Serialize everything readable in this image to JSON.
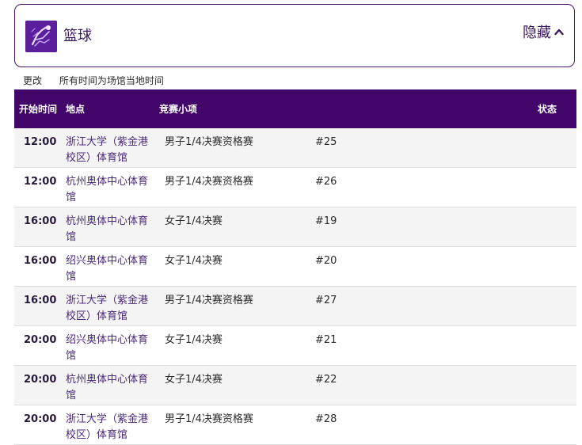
{
  "sport": {
    "title": "篮球",
    "hide_label": "隐藏",
    "logo_color": "#5c1f9c",
    "card_border_color": "#4a1466",
    "toggle_icon": "chevron-up-icon"
  },
  "subbar": {
    "change_label": "更改",
    "timezone_note": "所有时间为场馆当地时间"
  },
  "table": {
    "header_color": "#42066b",
    "columns": {
      "time": "开始时间",
      "venue": "地点",
      "event": "竞赛小项",
      "status": "状态"
    },
    "rows": [
      {
        "time": "12:00",
        "venue": "浙江大学（紫金港校区）体育馆",
        "event": "男子1/4决赛资格赛",
        "num": "#25"
      },
      {
        "time": "12:00",
        "venue": "杭州奥体中心体育馆",
        "event": "男子1/4决赛资格赛",
        "num": "#26"
      },
      {
        "time": "16:00",
        "venue": "杭州奥体中心体育馆",
        "event": "女子1/4决赛",
        "num": "#19"
      },
      {
        "time": "16:00",
        "venue": "绍兴奥体中心体育馆",
        "event": "女子1/4决赛",
        "num": "#20"
      },
      {
        "time": "16:00",
        "venue": "浙江大学（紫金港校区）体育馆",
        "event": "男子1/4决赛资格赛",
        "num": "#27"
      },
      {
        "time": "20:00",
        "venue": "绍兴奥体中心体育馆",
        "event": "女子1/4决赛",
        "num": "#21"
      },
      {
        "time": "20:00",
        "venue": "杭州奥体中心体育馆",
        "event": "女子1/4决赛",
        "num": "#22"
      },
      {
        "time": "20:00",
        "venue": "浙江大学（紫金港校区）体育馆",
        "event": "男子1/4决赛资格赛",
        "num": "#28"
      }
    ]
  }
}
